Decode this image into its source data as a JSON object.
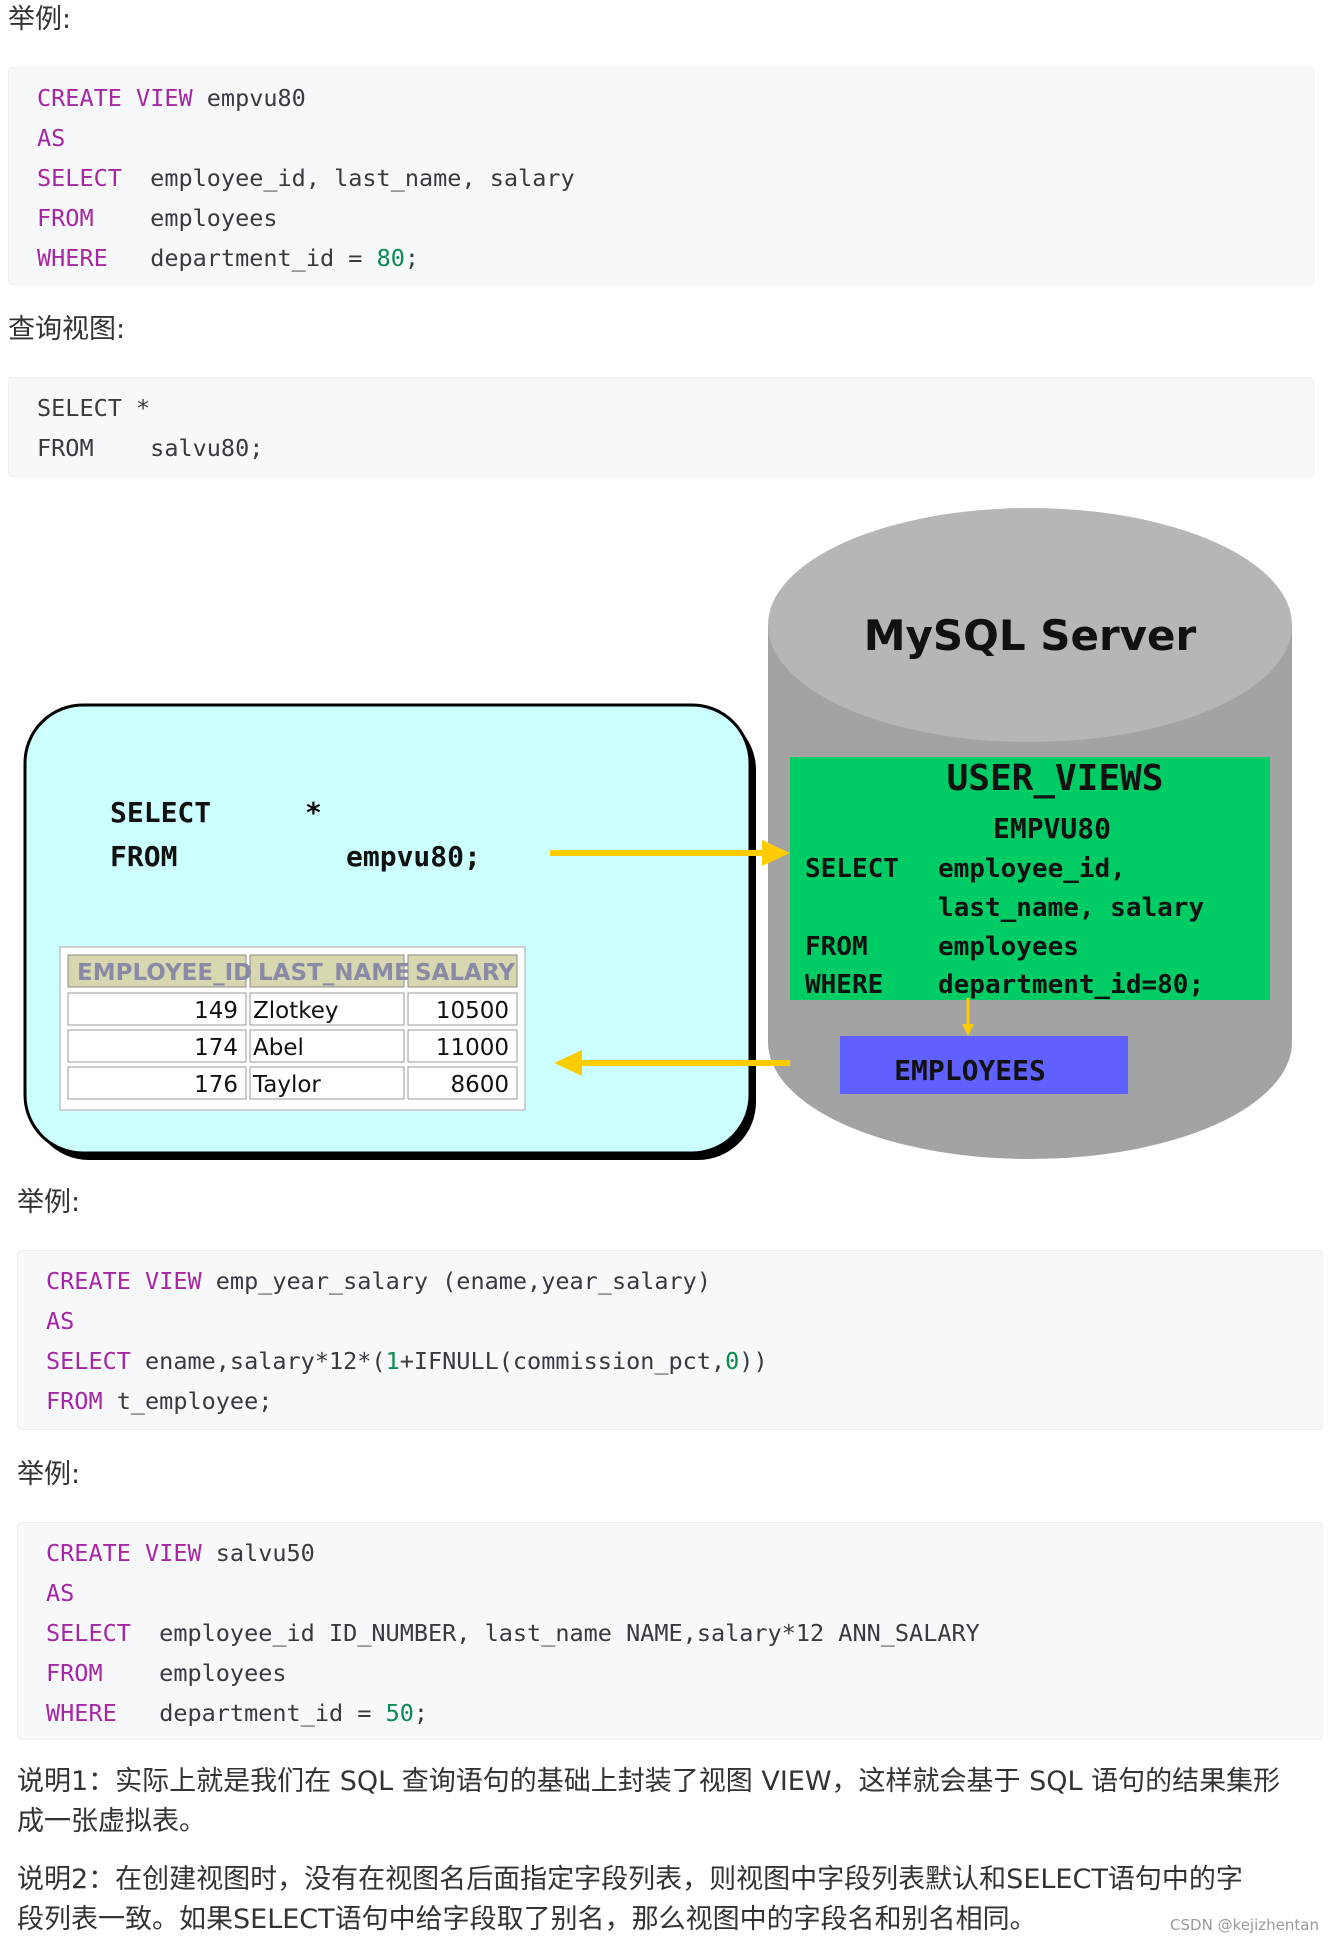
{
  "labels": {
    "example1": "举例:",
    "query_view": "查询视图:",
    "example2": "举例:",
    "example3": "举例:"
  },
  "code1": [
    {
      "k1": "CREATE",
      "k2": "VIEW",
      "rest": " empvu80"
    },
    {
      "k1": "AS"
    },
    {
      "k1": "SELECT",
      "rest": "  employee_id, last_name, salary"
    },
    {
      "k1": "FROM",
      "rest": "    employees"
    },
    {
      "k1": "WHERE",
      "rest": "   department_id = ",
      "num": "80",
      "tail": ";"
    }
  ],
  "code2": [
    "SELECT *",
    "FROM    salvu80;"
  ],
  "code3": [
    {
      "k1": "CREATE",
      "k2": "VIEW",
      "rest": " emp_year_salary (ename,year_salary)"
    },
    {
      "k1": "AS"
    },
    {
      "k1": "SELECT",
      "rest": " ename,salary*12*(",
      "num": "1",
      "tail": "+IFNULL(commission_pct,",
      "num2": "0",
      "tail2": "))"
    },
    {
      "k1": "FROM",
      "rest": " t_employee;"
    }
  ],
  "code4": [
    {
      "k1": "CREATE",
      "k2": "VIEW",
      "rest": " salvu50"
    },
    {
      "k1": "AS"
    },
    {
      "k1": "SELECT",
      "rest": "  employee_id ID_NUMBER, last_name NAME,salary*12 ANN_SALARY"
    },
    {
      "k1": "FROM",
      "rest": "    employees"
    },
    {
      "k1": "WHERE",
      "rest": "   department_id = ",
      "num": "50",
      "tail": ";"
    }
  ],
  "diagram": {
    "server_title": "MySQL Server",
    "user_views": "USER_VIEWS",
    "view_name": "EMPVU80",
    "view_sql": [
      [
        "SELECT",
        "employee_id,"
      ],
      [
        "",
        "last_name, salary"
      ],
      [
        "FROM",
        "employees"
      ],
      [
        "WHERE",
        "department_id=80;"
      ]
    ],
    "employees_table": "EMPLOYEES",
    "client_query": [
      "SELECT",
      "*",
      "FROM",
      "empvu80;"
    ],
    "result_table": {
      "headers": [
        "EMPLOYEE_ID",
        "LAST_NAME",
        "SALARY"
      ],
      "rows": [
        [
          "149",
          "Zlotkey",
          "10500"
        ],
        [
          "174",
          "Abel",
          "11000"
        ],
        [
          "176",
          "Taylor",
          "8600"
        ]
      ]
    },
    "colors": {
      "client_bg": "#ccffff",
      "cylinder": "#a3a3a3",
      "view_box": "#00cc66",
      "employees_box": "#6060ff",
      "arrow": "#ffcc00"
    }
  },
  "paragraphs": [
    [
      "说明1：实际上就是我们在 SQL 查询语句的基础上封装了视图 VIEW，这样就会基于 SQL 语句的结果集形",
      "成一张虚拟表。"
    ],
    [
      "说明2：在创建视图时，没有在视图名后面指定字段列表，则视图中字段列表默认和SELECT语句中的字",
      "段列表一致。如果SELECT语句中给字段取了别名，那么视图中的字段名和别名相同。"
    ]
  ],
  "watermark": "CSDN @kejizhentan"
}
